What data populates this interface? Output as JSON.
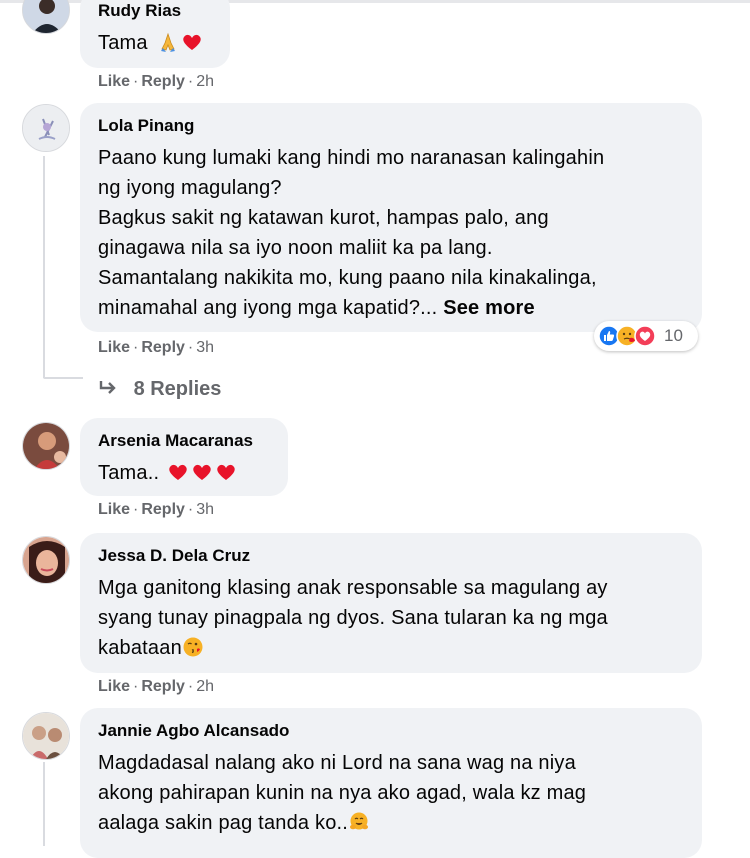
{
  "comments": [
    {
      "author": "Rudy Rias",
      "text": "Tama",
      "like": "Like",
      "reply": "Reply",
      "time": "2h"
    },
    {
      "author": "Lola Pinang",
      "lines": [
        "Paano kung lumaki kang hindi mo naranasan kalingahin",
        "ng iyong magulang?",
        "Bagkus sakit ng katawan kurot, hampas palo, ang",
        "ginagawa nila sa iyo noon maliit ka pa lang.",
        "Samantalang nakikita mo, kung paano nila kinakalinga,",
        "minamahal ang iyong mga kapatid?..."
      ],
      "see_more": "See more",
      "like": "Like",
      "reply": "Reply",
      "time": "3h",
      "reaction_count": "10",
      "replies_label": "8 Replies"
    },
    {
      "author": "Arsenia Macaranas",
      "text": "Tama..",
      "like": "Like",
      "reply": "Reply",
      "time": "3h"
    },
    {
      "author": "Jessa D. Dela Cruz",
      "lines": [
        "Mga ganitong klasing anak responsable sa magulang ay",
        "syang tunay pinagpala ng dyos. Sana tularan ka ng mga",
        "kabataan"
      ],
      "like": "Like",
      "reply": "Reply",
      "time": "2h"
    },
    {
      "author": "Jannie Agbo Alcansado",
      "lines": [
        "Magdadasal nalang ako ni Lord na sana wag na niya",
        "akong pahirapan kunin na nya ako agad, wala kz mag",
        "aalaga sakin pag tanda ko.."
      ]
    }
  ],
  "separator": "·",
  "icons": {
    "prayer": "folded-hands-icon",
    "heart": "heart-icon",
    "reply_arrow": "reply-arrow-icon",
    "kiss": "kissing-face-icon",
    "hug": "hugging-face-icon",
    "like_reaction": "like-reaction-icon",
    "care_reaction": "care-reaction-icon",
    "love_reaction": "love-reaction-icon"
  },
  "colors": {
    "bubble": "#f0f2f5",
    "meta": "#65676b",
    "heart": "#f02849",
    "like_blue": "#1877f2"
  }
}
